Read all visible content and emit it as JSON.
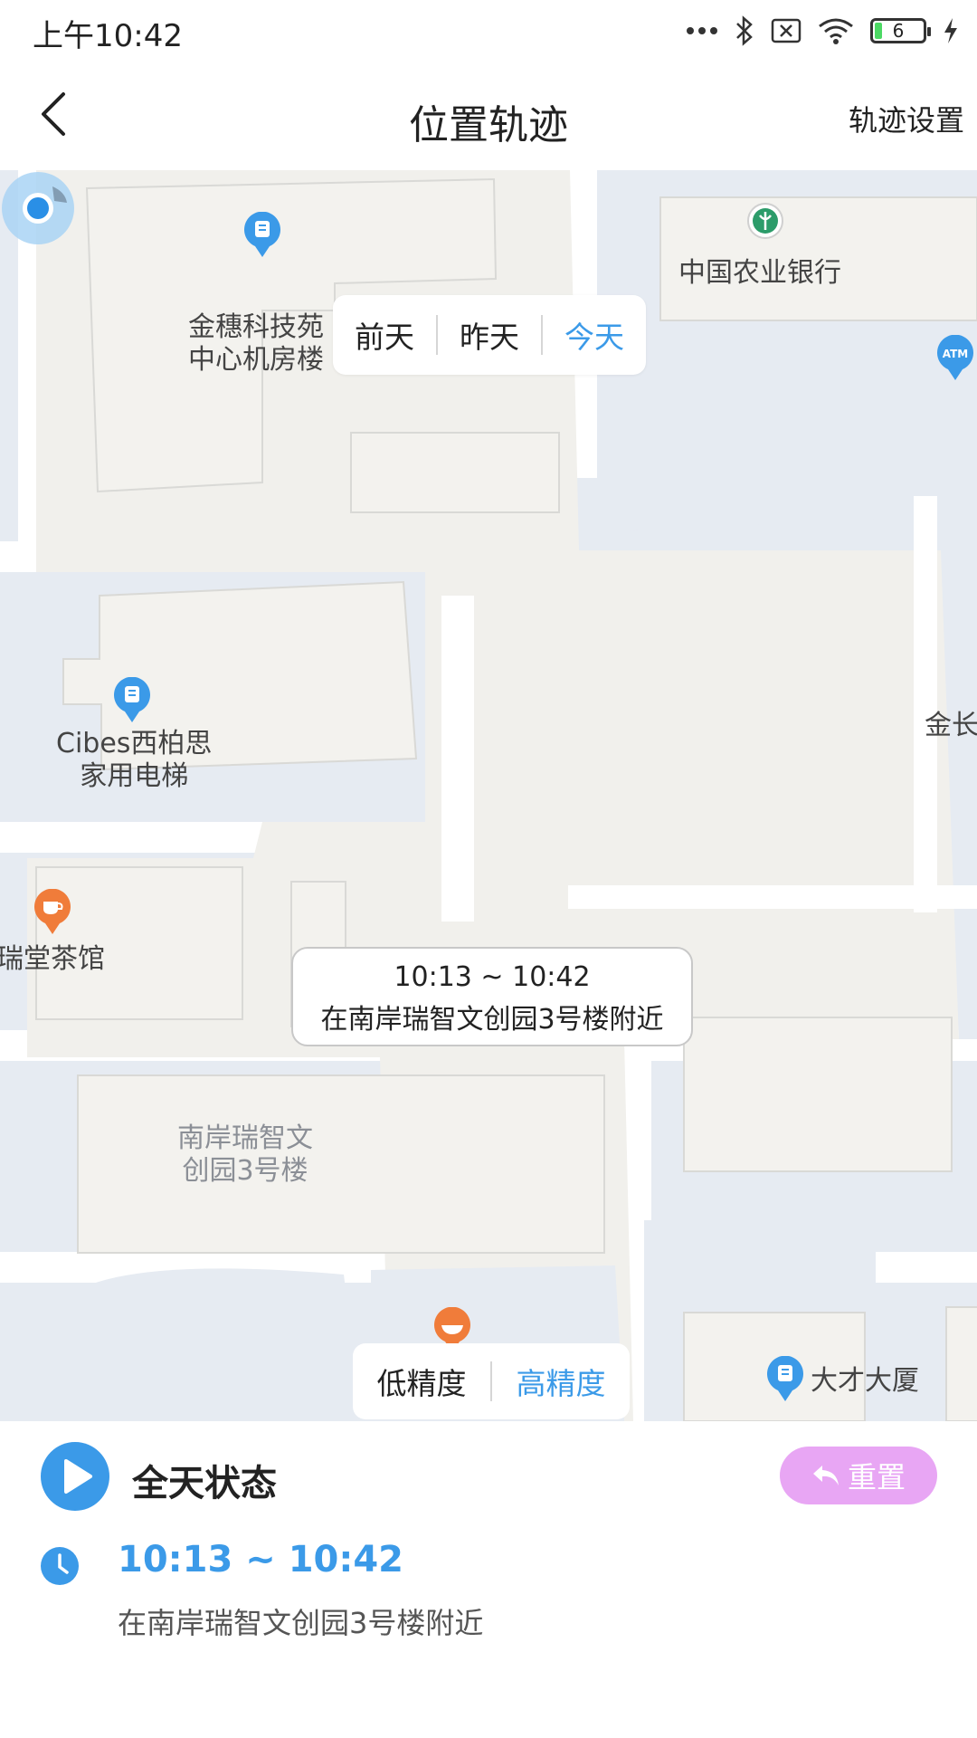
{
  "status_bar": {
    "time": "上午10:42",
    "battery_level": "6",
    "icons": [
      "more-dots-icon",
      "bluetooth-icon",
      "sim-off-icon",
      "wifi-icon",
      "battery-icon",
      "charging-icon"
    ]
  },
  "header": {
    "title": "位置轨迹",
    "settings_label": "轨迹设置"
  },
  "map": {
    "pois": {
      "jinsui": "金穗科技苑",
      "jinsui2": "中心机房楼",
      "bank": "中国农业银行",
      "cibes": "Cibes西柏思",
      "cibes2": "家用电梯",
      "tea": "佳瑞堂茶馆",
      "nanan": "南岸瑞智文",
      "nanan2": "创园3号楼",
      "dacai": "大才大厦",
      "jinchang": "金长"
    },
    "atm_label": "ATM"
  },
  "day_selector": {
    "options": [
      "前天",
      "昨天",
      "今天"
    ],
    "selected": "今天"
  },
  "callout": {
    "time_range": "10:13 ~ 10:42",
    "location": "在南岸瑞智文创园3号楼附近"
  },
  "precision_selector": {
    "options": [
      "低精度",
      "高精度"
    ],
    "selected": "高精度"
  },
  "panel": {
    "title": "全天状态",
    "reset_label": "重置",
    "entry": {
      "time_range": "10:13 ~ 10:42",
      "location": "在南岸瑞智文创园3号楼附近"
    }
  },
  "colors": {
    "accent": "#3b9ae8",
    "reset_button": "#e8a6f4",
    "map_block": "#f3f2ee",
    "map_water": "#e6ebf2",
    "poi_orange": "#f07c3a"
  }
}
